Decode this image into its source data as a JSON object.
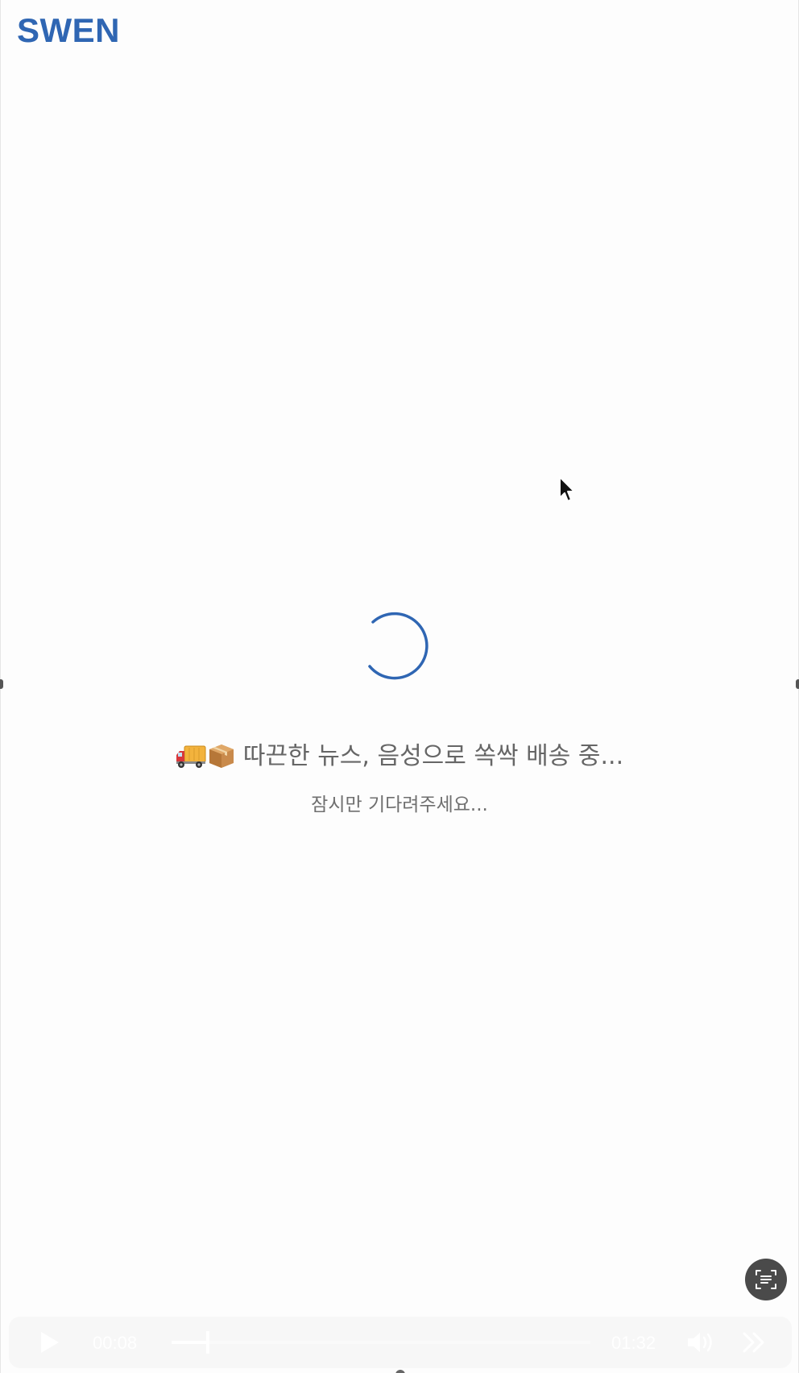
{
  "app": {
    "logo_text": "SWEN",
    "brand_color": "#2f66b3"
  },
  "loading": {
    "emoji_truck": "🚚",
    "emoji_package": "📦",
    "title": "따끈한 뉴스, 음성으로 쏙싹 배송 중...",
    "subtitle": "잠시만 기다려주세요..."
  },
  "fab": {
    "icon": "text-scan-icon"
  },
  "player": {
    "current_time": "00:08",
    "total_time": "01:32",
    "progress": 0.087,
    "play_icon": "play-icon",
    "volume_icon": "volume-icon",
    "skip_icon": "skip-forward-icon"
  }
}
